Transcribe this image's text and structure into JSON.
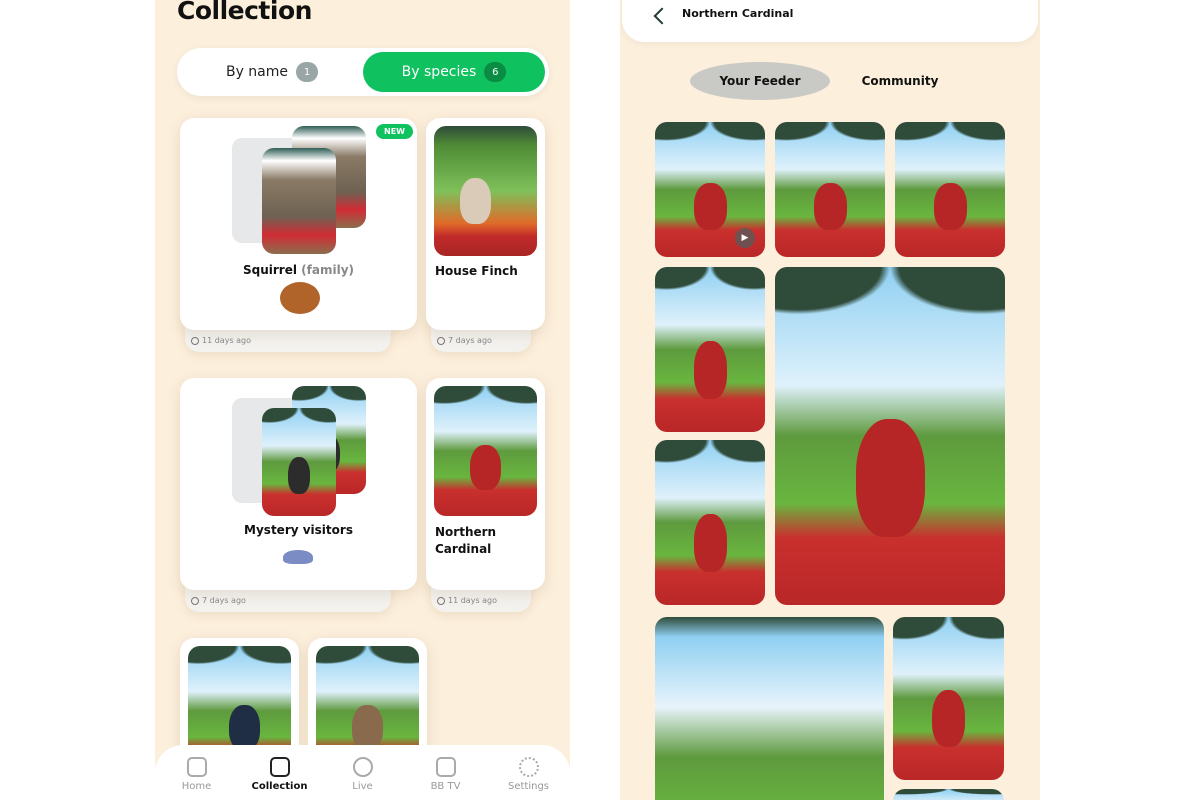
{
  "left": {
    "title": "Collection",
    "segments": [
      {
        "label": "By name",
        "count": "1"
      },
      {
        "label": "By species",
        "count": "6"
      }
    ],
    "cards": [
      {
        "name": "Squirrel",
        "suffix": "(family)",
        "badge": "NEW",
        "time": "11 days ago",
        "icon": "squirrel-icon"
      },
      {
        "name": "House Finch",
        "time": "7 days ago"
      },
      {
        "name": "Mystery visitors",
        "time": "7 days ago",
        "icon": "cowboy-hat-icon"
      },
      {
        "name": "Northern Cardinal",
        "time": "11 days ago"
      }
    ],
    "nav": [
      {
        "label": "Home",
        "icon": "home-icon"
      },
      {
        "label": "Collection",
        "icon": "collection-icon",
        "active": true
      },
      {
        "label": "Live",
        "icon": "live-icon"
      },
      {
        "label": "BB TV",
        "icon": "tv-play-icon"
      },
      {
        "label": "Settings",
        "icon": "gear-icon"
      }
    ]
  },
  "right": {
    "title": "Northern Cardinal",
    "tabs": [
      {
        "label": "Your Feeder",
        "active": true
      },
      {
        "label": "Community"
      }
    ],
    "colors": {
      "accent": "#0fc15f",
      "background": "#fcefdc"
    }
  }
}
